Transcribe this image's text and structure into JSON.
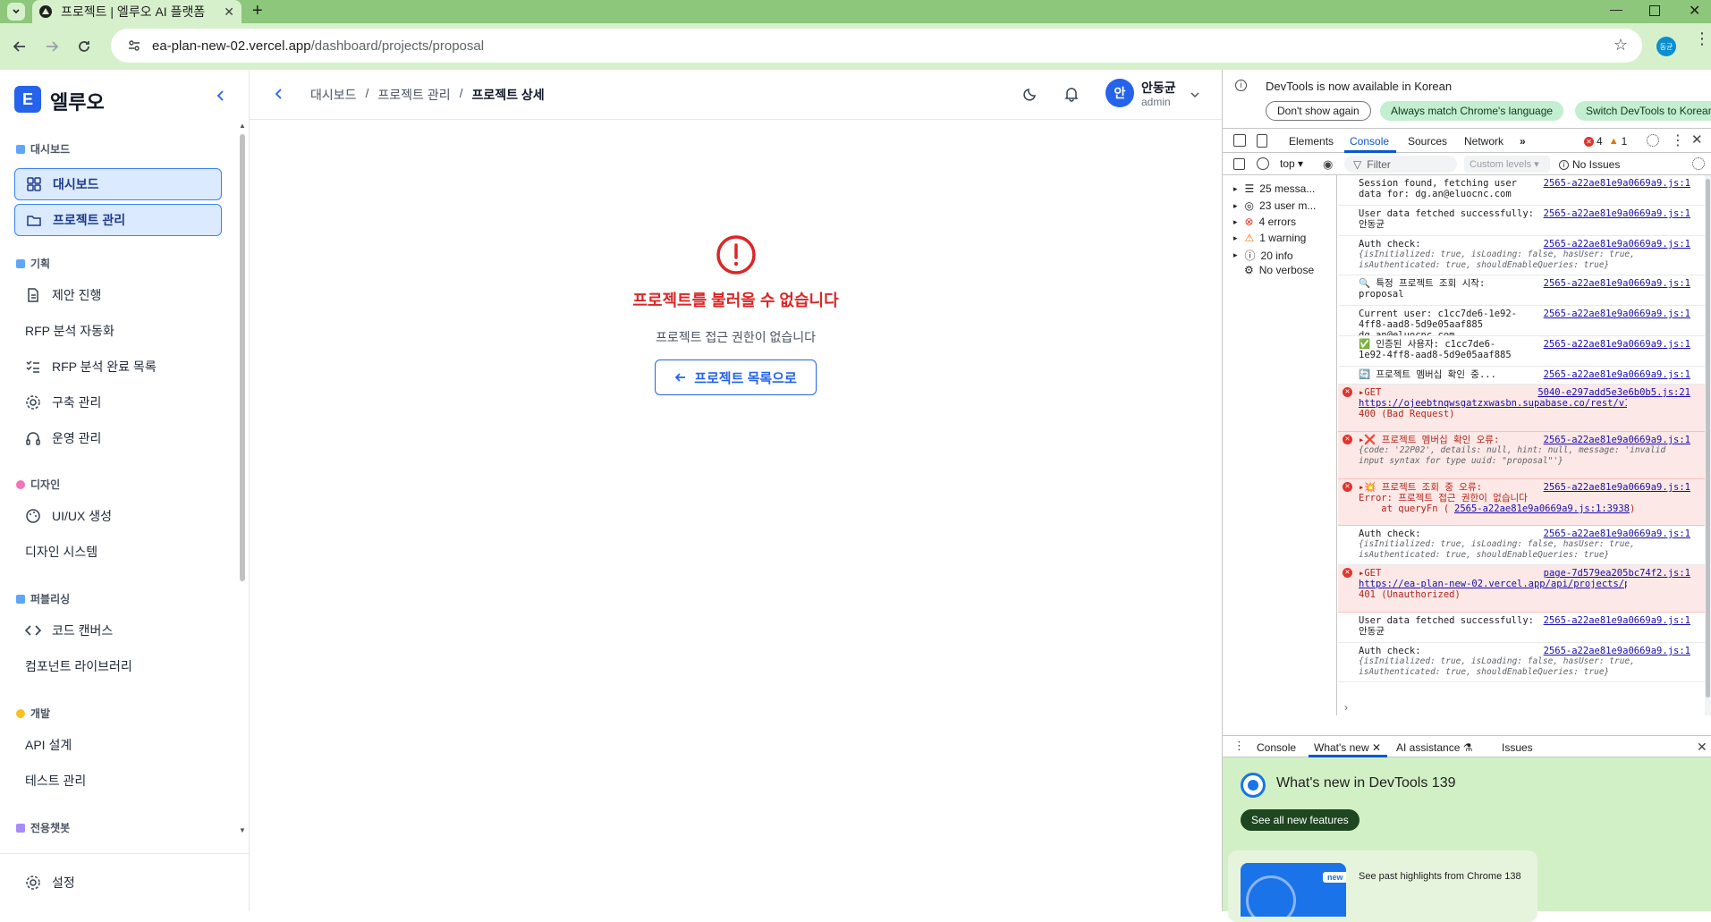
{
  "browser": {
    "tab_title": "프로젝트 | 엘루오 AI 플랫폼",
    "url_host": "ea-plan-new-02.vercel.app",
    "url_path": "/dashboard/projects/proposal",
    "profile_initial": "동균"
  },
  "sidebar": {
    "logo_letter": "E",
    "brand": "엘루오",
    "sections": [
      {
        "title": "대시보드"
      },
      {
        "title": "기획"
      },
      {
        "title": "디자인"
      },
      {
        "title": "퍼블리싱"
      },
      {
        "title": "개발"
      },
      {
        "title": "전용챗봇"
      }
    ],
    "items": [
      {
        "label": "대시보드"
      },
      {
        "label": "프로젝트 관리"
      },
      {
        "label": "제안 진행"
      },
      {
        "label": "RFP 분석 자동화"
      },
      {
        "label": "RFP 분석 완료 목록"
      },
      {
        "label": "구축 관리"
      },
      {
        "label": "운영 관리"
      },
      {
        "label": "UI/UX 생성"
      },
      {
        "label": "디자인 시스템"
      },
      {
        "label": "코드 캔버스"
      },
      {
        "label": "컴포넌트 라이브러리"
      },
      {
        "label": "API 설계"
      },
      {
        "label": "테스트 관리"
      }
    ],
    "settings_label": "설정"
  },
  "header": {
    "breadcrumb": [
      "대시보드",
      "/",
      "프로젝트 관리",
      "/",
      "프로젝트 상세"
    ],
    "user_initial": "안",
    "user_name": "안동균",
    "user_role": "admin"
  },
  "main": {
    "error_title": "프로젝트를 불러올 수 없습니다",
    "error_message": "프로젝트 접근 권한이 없습니다",
    "back_button": "프로젝트 목록으로"
  },
  "devtools": {
    "notice": "DevTools is now available in Korean",
    "notice_buttons": [
      "Don't show again",
      "Always match Chrome's language",
      "Switch DevTools to Korean"
    ],
    "tabs": [
      "Elements",
      "Console",
      "Sources",
      "Network"
    ],
    "error_count": "4",
    "warning_count": "1",
    "context": "top",
    "filter_placeholder": "Filter",
    "levels": "Custom levels",
    "issues": "No Issues",
    "sidebar": [
      "25 messa...",
      "23 user m...",
      "4 errors",
      "1 warning",
      "20 info",
      "No verbose"
    ],
    "logs": [
      {
        "msg": "Session found, fetching user\ndata for: dg.an@eluocnc.com",
        "src": "2565-a22ae81e9a0669a9.js:1"
      },
      {
        "msg": "User data fetched successfully:\n안동균",
        "src": "2565-a22ae81e9a0669a9.js:1"
      },
      {
        "msg": "Auth check:",
        "obj": "{isInitialized: true, isLoading: false, hasUser: true, isAuthenticated: true, shouldEnableQueries: true}",
        "src": "2565-a22ae81e9a0669a9.js:1"
      },
      {
        "msg": "🔍 특정 프로젝트 조회 시작:\nproposal",
        "src": "2565-a22ae81e9a0669a9.js:1"
      },
      {
        "msg": "Current user: c1cc7de6-1e92-\n4ff8-aad8-5d9e05aaf885 dg.an@eluocnc.com",
        "src": "2565-a22ae81e9a0669a9.js:1"
      },
      {
        "msg": "✅ 인증된 사용자: c1cc7de6-\n1e92-4ff8-aad8-5d9e05aaf885",
        "src": "2565-a22ae81e9a0669a9.js:1"
      },
      {
        "msg": "🔄 프로젝트 멤버십 확인 중...",
        "src": "2565-a22ae81e9a0669a9.js:1"
      },
      {
        "msg": "▸GET",
        "link": "https://ojeebtnqwsgatzxwasbn.supabase.co/rest/v1/project_…",
        "after": "400 (Bad Request)",
        "src": "5040-e297add5e3e6b0b5.js:21",
        "error": true
      },
      {
        "msg": "▸❌ 프로젝트 멤버십 확인 오류:",
        "obj": "{code: '22P02', details: null, hint: null, message: 'invalid input syntax for type uuid: \"proposal\"'}",
        "src": "2565-a22ae81e9a0669a9.js:1",
        "error": true
      },
      {
        "msg": "▸💥 프로젝트 조회 중 오류:\nError: 프로젝트 접근 권한이 없습니다\n    at queryFn (",
        "link": "2565-a22ae81e9a0669a9.js:1:3938",
        "after": ")",
        "src": "2565-a22ae81e9a0669a9.js:1",
        "error": true
      },
      {
        "msg": "Auth check:",
        "obj": "{isInitialized: true, isLoading: false, hasUser: true, isAuthenticated: true, shouldEnableQueries: true}",
        "src": "2565-a22ae81e9a0669a9.js:1"
      },
      {
        "msg": "▸GET",
        "link": "https://ea-plan-new-02.vercel.app/api/projects/proposal/m…",
        "after": "401 (Unauthorized)",
        "src": "page-7d579ea205bc74f2.js:1",
        "error": true
      },
      {
        "msg": "User data fetched successfully:\n안동균",
        "src": "2565-a22ae81e9a0669a9.js:1"
      },
      {
        "msg": "Auth check:",
        "obj": "{isInitialized: true, isLoading: false, hasUser: true, isAuthenticated: true, shouldEnableQueries: true}",
        "src": "2565-a22ae81e9a0669a9.js:1"
      }
    ],
    "drawer_tabs": [
      "Console",
      "What's new",
      "AI assistance",
      "Issues"
    ],
    "whatsnew_title": "What's new in DevTools 139",
    "whatsnew_button": "See all new features",
    "highlight_badge": "new",
    "highlight_text": "See past highlights from Chrome 138"
  },
  "colors": {
    "accent": "#2563eb",
    "error": "#dc2626",
    "chrome_frame": "#8cc77b",
    "chrome_toolbar": "#d7f0cc"
  }
}
